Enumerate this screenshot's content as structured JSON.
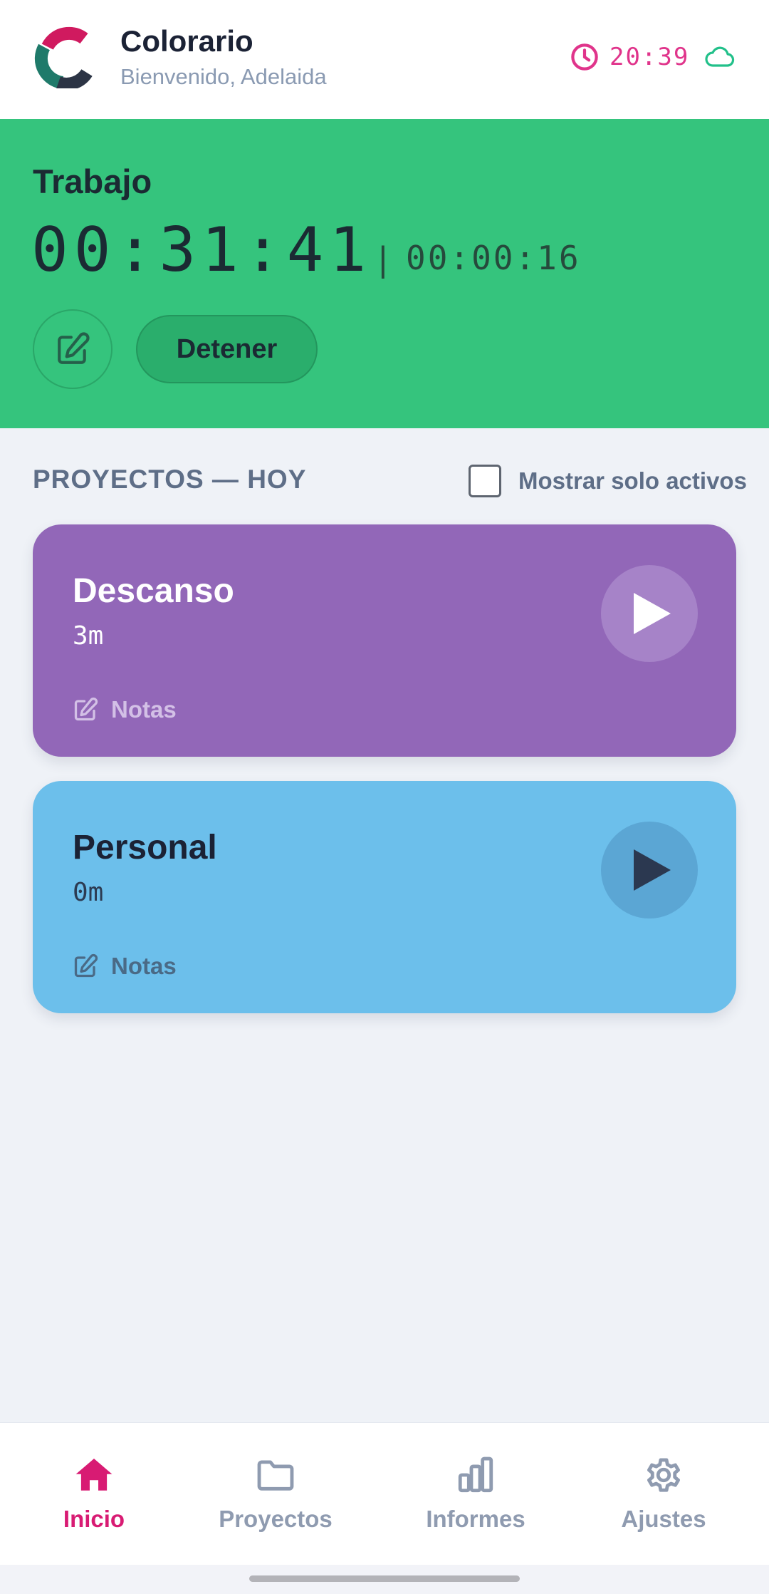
{
  "header": {
    "app_name": "Colorario",
    "welcome": "Bienvenido, Adelaida",
    "clock_time": "20:39",
    "icons": {
      "clock": "clock-icon",
      "sync": "cloud-icon"
    },
    "accent_color": "#e0348b"
  },
  "active_timer": {
    "project": "Trabajo",
    "elapsed": "00:31:41",
    "separator": "|",
    "session_elapsed": "00:00:16",
    "stop_label": "Detener",
    "color": "#35c47d"
  },
  "projects_section": {
    "title": "PROYECTOS — HOY",
    "filter_label": "Mostrar solo activos",
    "filter_checked": false
  },
  "projects": [
    {
      "name": "Descanso",
      "time": "3m",
      "notes_label": "Notas",
      "color": "#9267b8"
    },
    {
      "name": "Personal",
      "time": "0m",
      "notes_label": "Notas",
      "color": "#6cbfeb"
    }
  ],
  "nav": {
    "items": [
      {
        "label": "Inicio",
        "icon": "home-icon",
        "active": true
      },
      {
        "label": "Proyectos",
        "icon": "folder-icon",
        "active": false
      },
      {
        "label": "Informes",
        "icon": "bar-chart-icon",
        "active": false
      },
      {
        "label": "Ajustes",
        "icon": "gear-icon",
        "active": false
      }
    ],
    "active_color": "#d81b73"
  }
}
